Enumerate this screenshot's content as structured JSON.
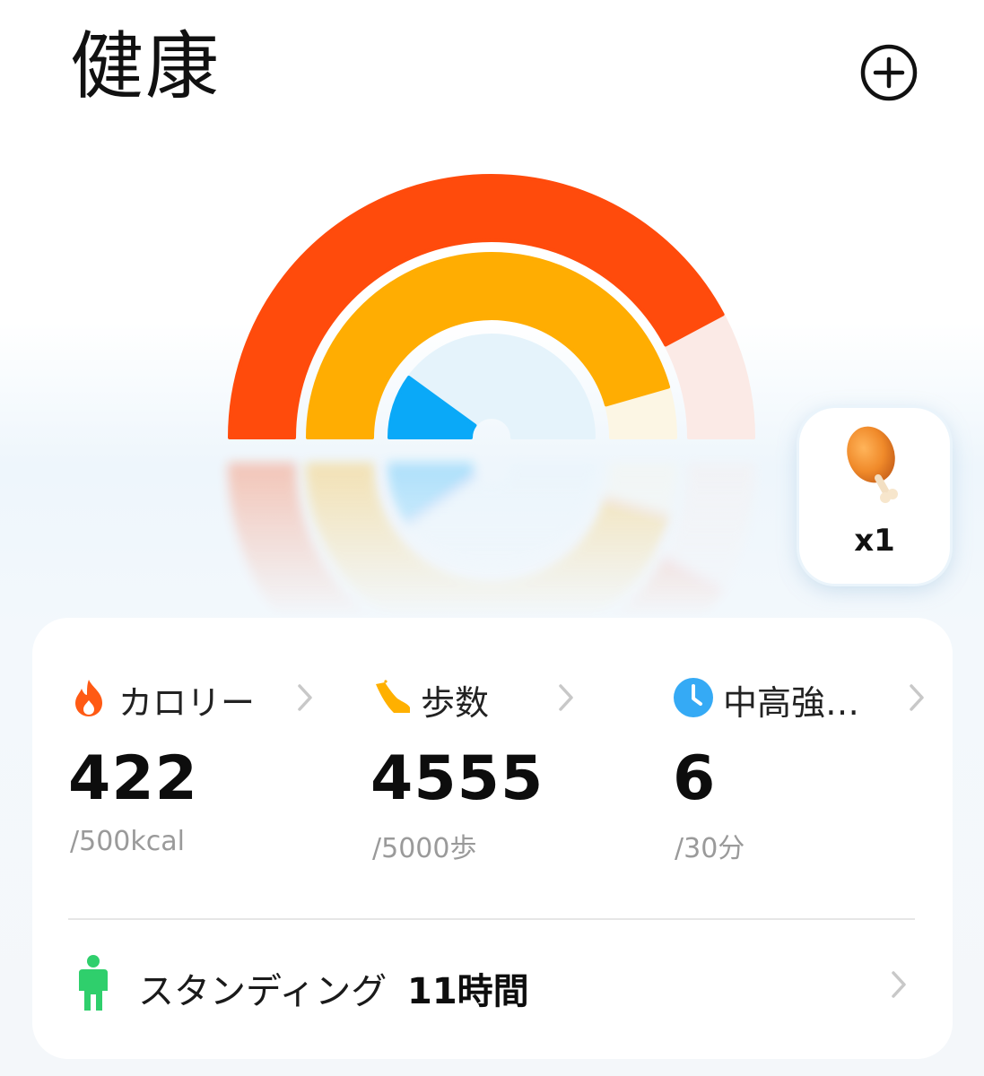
{
  "header": {
    "title": "健康",
    "add_icon": "plus-circle-icon"
  },
  "colors": {
    "calorie": "#ff4b0c",
    "calorie_track": "#fbeae6",
    "steps": "#ffad02",
    "steps_track": "#fcf6e4",
    "intensity": "#0aa9f8",
    "intensity_track": "#e5f3fb"
  },
  "rings": {
    "calorie_progress": 0.844,
    "steps_progress": 0.911,
    "intensity_progress": 0.2
  },
  "reward": {
    "icon": "drumstick-icon",
    "count": "x1"
  },
  "metrics": [
    {
      "icon": "flame-icon",
      "label": "カロリー",
      "value": "422",
      "goal": "/500kcal"
    },
    {
      "icon": "shoe-icon",
      "label": "歩数",
      "value": "4555",
      "goal": "/5000歩"
    },
    {
      "icon": "clock-icon",
      "label": "中高強…",
      "value": "6",
      "goal": "/30分"
    }
  ],
  "standing": {
    "icon": "person-standing-icon",
    "label": "スタンディング",
    "value": "11時間"
  }
}
